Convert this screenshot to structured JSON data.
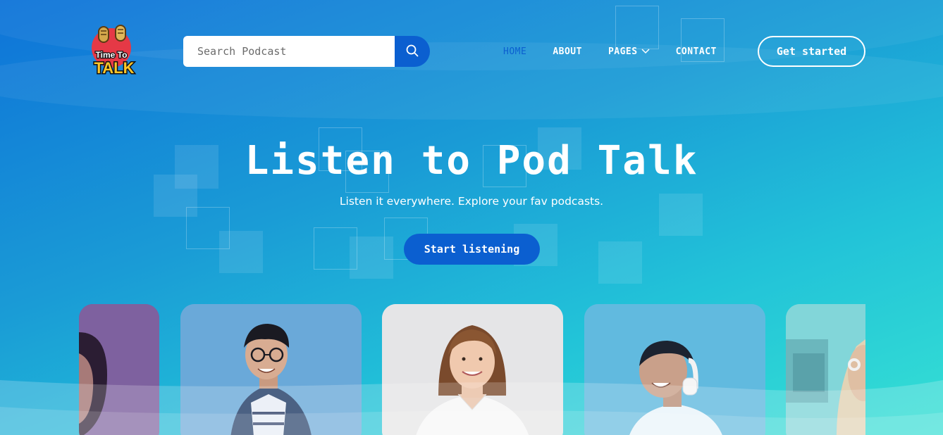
{
  "brand": {
    "logo_line1": "Time To",
    "logo_line2": "TALK"
  },
  "search": {
    "placeholder": "Search Podcast",
    "icon": "search-icon"
  },
  "nav": {
    "items": [
      {
        "label": "HOME",
        "active": true
      },
      {
        "label": "ABOUT",
        "active": false
      },
      {
        "label": "PAGES",
        "active": false,
        "icon": "chevron-down-icon"
      },
      {
        "label": "CONTACT",
        "active": false
      }
    ]
  },
  "cta": {
    "label": "Get started"
  },
  "hero": {
    "title": "Listen to Pod Talk",
    "subtitle": "Listen it everywhere. Explore your fav podcasts.",
    "button": "Start listening"
  },
  "colors": {
    "accent": "#0b5fd0",
    "gradient_start": "#0e73d8",
    "gradient_end": "#35e0d4"
  }
}
